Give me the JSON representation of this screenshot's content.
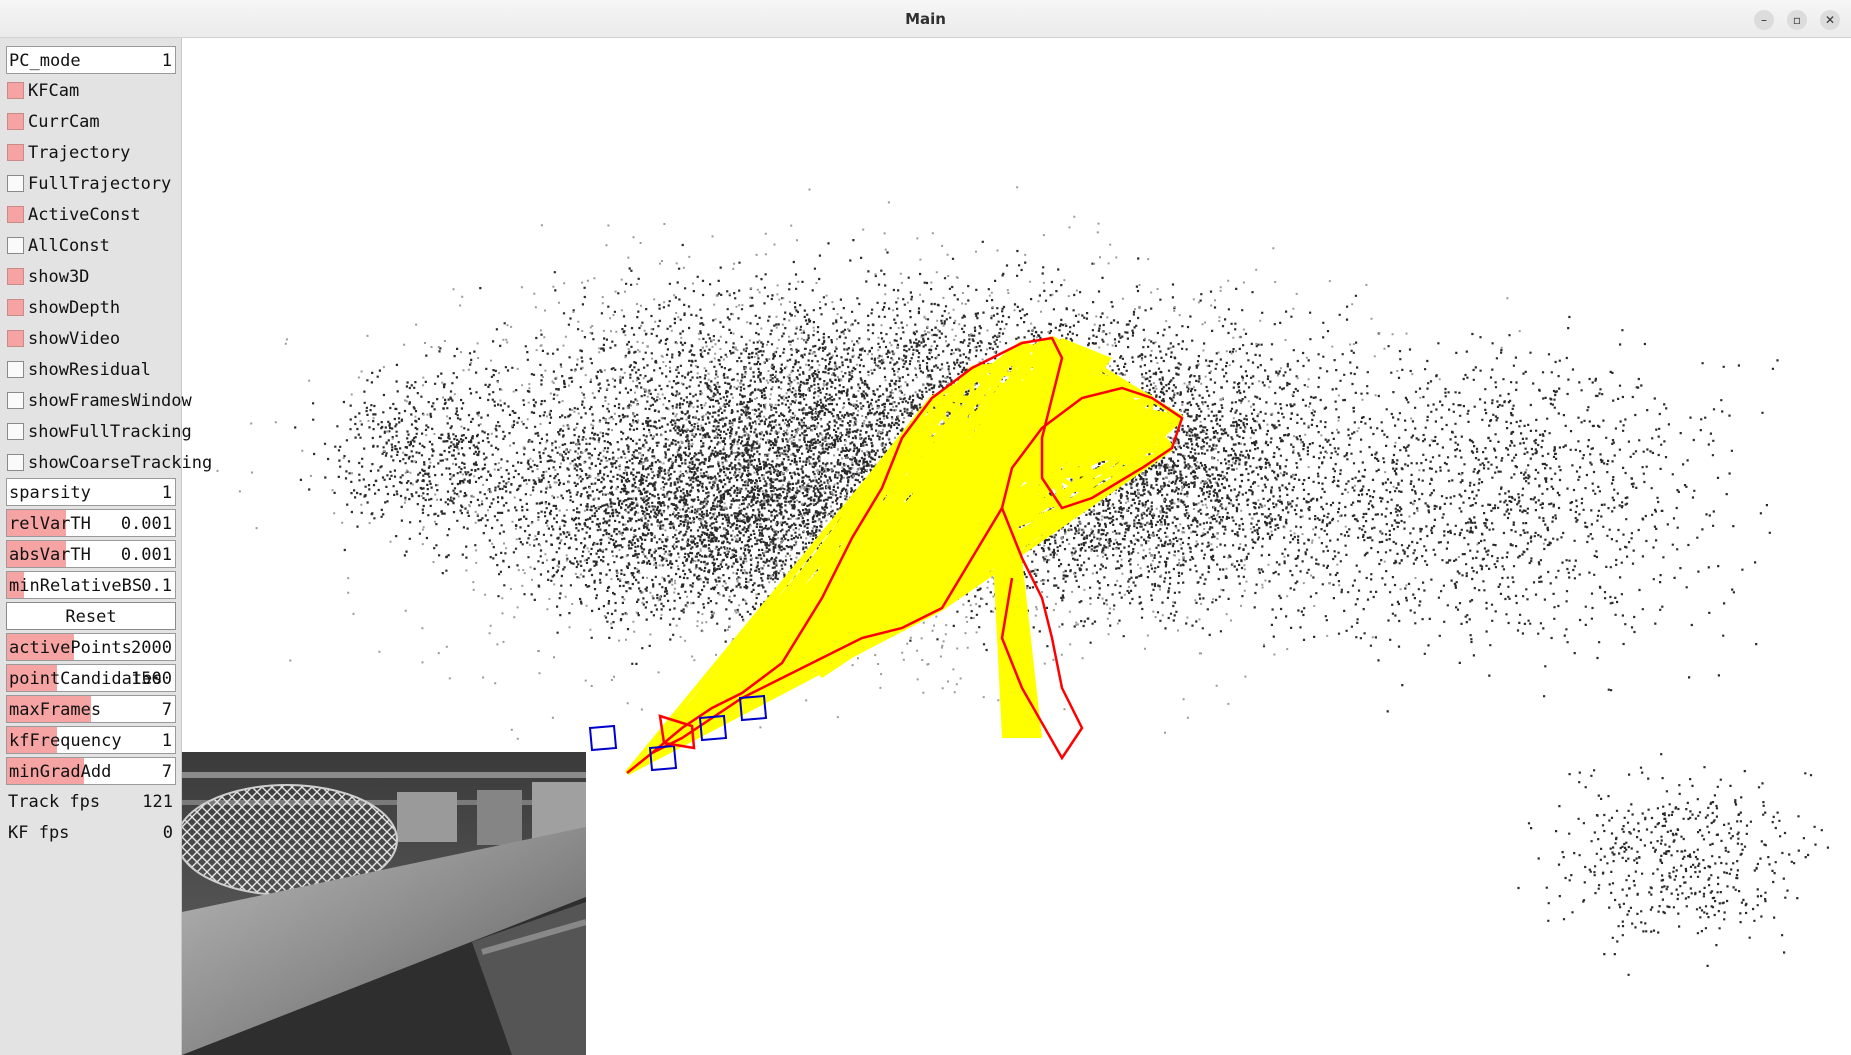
{
  "window": {
    "title": "Main",
    "minimize": "–",
    "maximize": "▫",
    "close": "✕"
  },
  "panel": {
    "pc_mode": {
      "label": "PC_mode",
      "value": "1"
    },
    "checkboxes": [
      {
        "label": "KFCam",
        "checked": true
      },
      {
        "label": "CurrCam",
        "checked": true
      },
      {
        "label": "Trajectory",
        "checked": true
      },
      {
        "label": "FullTrajectory",
        "checked": false
      },
      {
        "label": "ActiveConst",
        "checked": true
      },
      {
        "label": "AllConst",
        "checked": false
      },
      {
        "label": "show3D",
        "checked": true
      },
      {
        "label": "showDepth",
        "checked": true
      },
      {
        "label": "showVideo",
        "checked": true
      },
      {
        "label": "showResidual",
        "checked": false
      },
      {
        "label": "showFramesWindow",
        "checked": false
      },
      {
        "label": "showFullTracking",
        "checked": false
      },
      {
        "label": "showCoarseTracking",
        "checked": false
      }
    ],
    "sparsity": {
      "label": "sparsity",
      "value": "1"
    },
    "relVarTH": {
      "label": "relVarTH",
      "value": "0.001",
      "fill": 0.35
    },
    "absVarTH": {
      "label": "absVarTH",
      "value": "0.001",
      "fill": 0.35
    },
    "minRelativeBS": {
      "label": "minRelativeBS",
      "value": "0.1",
      "fill": 0.1
    },
    "reset": {
      "label": "Reset"
    },
    "activePoints": {
      "label": "activePoints",
      "value": "2000",
      "fill": 0.4
    },
    "pointCandidates": {
      "label": "pointCandidates",
      "value": "1500",
      "fill": 0.3
    },
    "maxFrames": {
      "label": "maxFrames",
      "value": "7",
      "fill": 0.5
    },
    "kfFrequency": {
      "label": "kfFrequency",
      "value": "1",
      "fill": 0.3
    },
    "minGradAdd": {
      "label": "minGradAdd",
      "value": "7",
      "fill": 0.46
    },
    "track_fps": {
      "label": "Track fps",
      "value": "121"
    },
    "kf_fps": {
      "label": "KF fps",
      "value": "0"
    }
  },
  "colors": {
    "slider_fill": "#f5a3a3",
    "trajectory": "#ff0000",
    "constraints": "#ffff00",
    "camera": "#0000cc",
    "points": "#000000"
  }
}
